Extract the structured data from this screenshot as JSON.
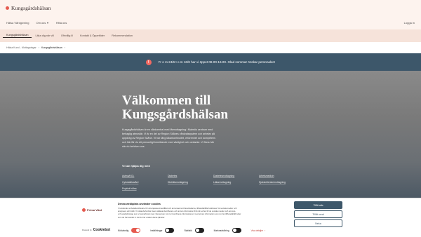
{
  "header": {
    "logo_text": "Kungsgårdshälsan",
    "nav": [
      "Hälsa Vårdgivning",
      "Om oss",
      "Hitta oss"
    ],
    "login": "Logga in"
  },
  "subnav": {
    "items": [
      "Kungsgårdshälsan",
      "Läka dig när vill",
      "Ofrivillig ill",
      "Kontakt & Öppettider",
      "Rekommendation"
    ]
  },
  "breadcrumb": [
    "Hälsa Kund - Mottagningar",
    "Kungsgårdshälsan"
  ],
  "alert": {
    "icon": "!",
    "text": "Fr o m 24/6 t o m 16/8 har vi öppet 08.00-16.00. Glad sommar önskar personalen!"
  },
  "hero": {
    "title_lines": [
      "Välkommen till",
      "Kungsgårdshälsan"
    ],
    "body_lines": [
      "Kungsgårdshälsan är en vårdcentral med färmottagning i Malmös centrum med",
      "behaglig atmosfär. Vi är en del av Region Skånes vårdvalssystem och arbetar på",
      "uppdrag av Region Skåne. Vi har lång läkarkontinuitet, erfarenhet och kompetens",
      "och här får du ett personligt bemötande med vänlighet och omtanke. Vi finns här",
      "när du behöver oss."
    ],
    "help_title": "Vi kan hjälpa dig med",
    "links": [
      "Astma/KOL",
      "Diabetes",
      "Diabetesmottagning",
      "Arbetsmedicin",
      "Cytostatikavård",
      "Distriktsmottagning",
      "Läkarmottagning",
      "Sjuksköterskemottagning",
      "Psykisk hälsa"
    ]
  },
  "cookie": {
    "logo_text": "Prima Vård",
    "powered_label": "Powered by",
    "powered_brand": "Cookiebot",
    "title": "Denna webbplats använder cookies",
    "text_lines": [
      "Vi använder enhetsidentifierare för att anpassa innehållet och annonserna till användarna, tillhandahålla funktioner för sociala medier och",
      "analysera vår trafik. Vi vidarebefordrar även sådana identifierare och annan information från din enhet till de sociala medier och annons-",
      "och analysföretag som vi samarbetar med. Dessa kan i sin tur kombinera informationen med annan information som du har tillhandahållit eller",
      "som de har samlat in när du har använt deras tjänster."
    ],
    "toggles": [
      {
        "label": "Nödvändig",
        "on": true
      },
      {
        "label": "Inställningar",
        "on": false
      },
      {
        "label": "Statistik",
        "on": false
      },
      {
        "label": "Marknadsföring",
        "on": false
      }
    ],
    "details_label": "Visa detaljer",
    "accept_all": "Tillåt alla",
    "allow_selection": "Tillåt urval",
    "deny": "Neka"
  }
}
